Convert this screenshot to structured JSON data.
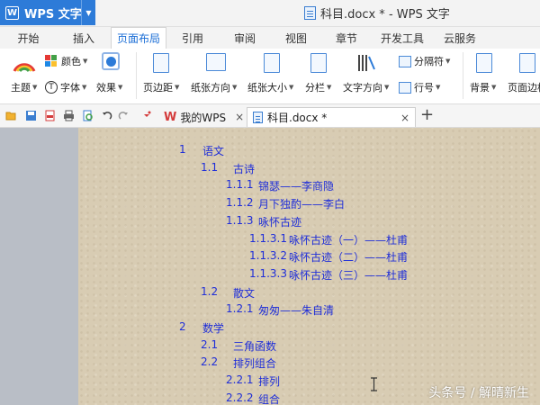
{
  "app": {
    "name": "WPS 文字",
    "logo_letter": "W"
  },
  "window": {
    "title": "科目.docx * - WPS 文字"
  },
  "menu": {
    "tabs": [
      {
        "label": "开始"
      },
      {
        "label": "插入"
      },
      {
        "label": "页面布局",
        "active": true
      },
      {
        "label": "引用"
      },
      {
        "label": "审阅"
      },
      {
        "label": "视图"
      },
      {
        "label": "章节"
      },
      {
        "label": "开发工具"
      },
      {
        "label": "云服务"
      }
    ]
  },
  "ribbon": {
    "theme": "主题",
    "color": "颜色",
    "font": "字体",
    "effect": "效果",
    "margins": "页边距",
    "orientation": "纸张方向",
    "size": "纸张大小",
    "columns": "分栏",
    "text_direction": "文字方向",
    "breaks": "分隔符",
    "line_numbers": "行号",
    "background": "背景",
    "page_border": "页面边框"
  },
  "doc_tabs": [
    {
      "label": "我的WPS",
      "close": "×"
    },
    {
      "label": "科目.docx *",
      "close": "×",
      "active": true
    }
  ],
  "new_tab": "+",
  "toc": [
    {
      "num": "1",
      "text": "语文"
    },
    {
      "num": "1.1",
      "text": "古诗"
    },
    {
      "num": "1.1.1",
      "text": "锦瑟——李商隐"
    },
    {
      "num": "1.1.2",
      "text": "月下独酌——李白"
    },
    {
      "num": "1.1.3",
      "text": "咏怀古迹"
    },
    {
      "num": "1.1.3.1",
      "text": "咏怀古迹（一）——杜甫"
    },
    {
      "num": "1.1.3.2",
      "text": "咏怀古迹（二）——杜甫"
    },
    {
      "num": "1.1.3.3",
      "text": "咏怀古迹（三）——杜甫"
    },
    {
      "num": "1.2",
      "text": "散文"
    },
    {
      "num": "1.2.1",
      "text": "匆匆——朱自清"
    },
    {
      "num": "2",
      "text": "数学"
    },
    {
      "num": "2.1",
      "text": "三角函数"
    },
    {
      "num": "2.2",
      "text": "排列组合"
    },
    {
      "num": "2.2.1",
      "text": "排列"
    },
    {
      "num": "2.2.2",
      "text": "组合"
    }
  ],
  "watermark": "头条号 / 解晴新生",
  "colors": {
    "accent": "#2d7bd8",
    "toc_text": "#1f2ed8",
    "paper": "#d8ccb3"
  }
}
